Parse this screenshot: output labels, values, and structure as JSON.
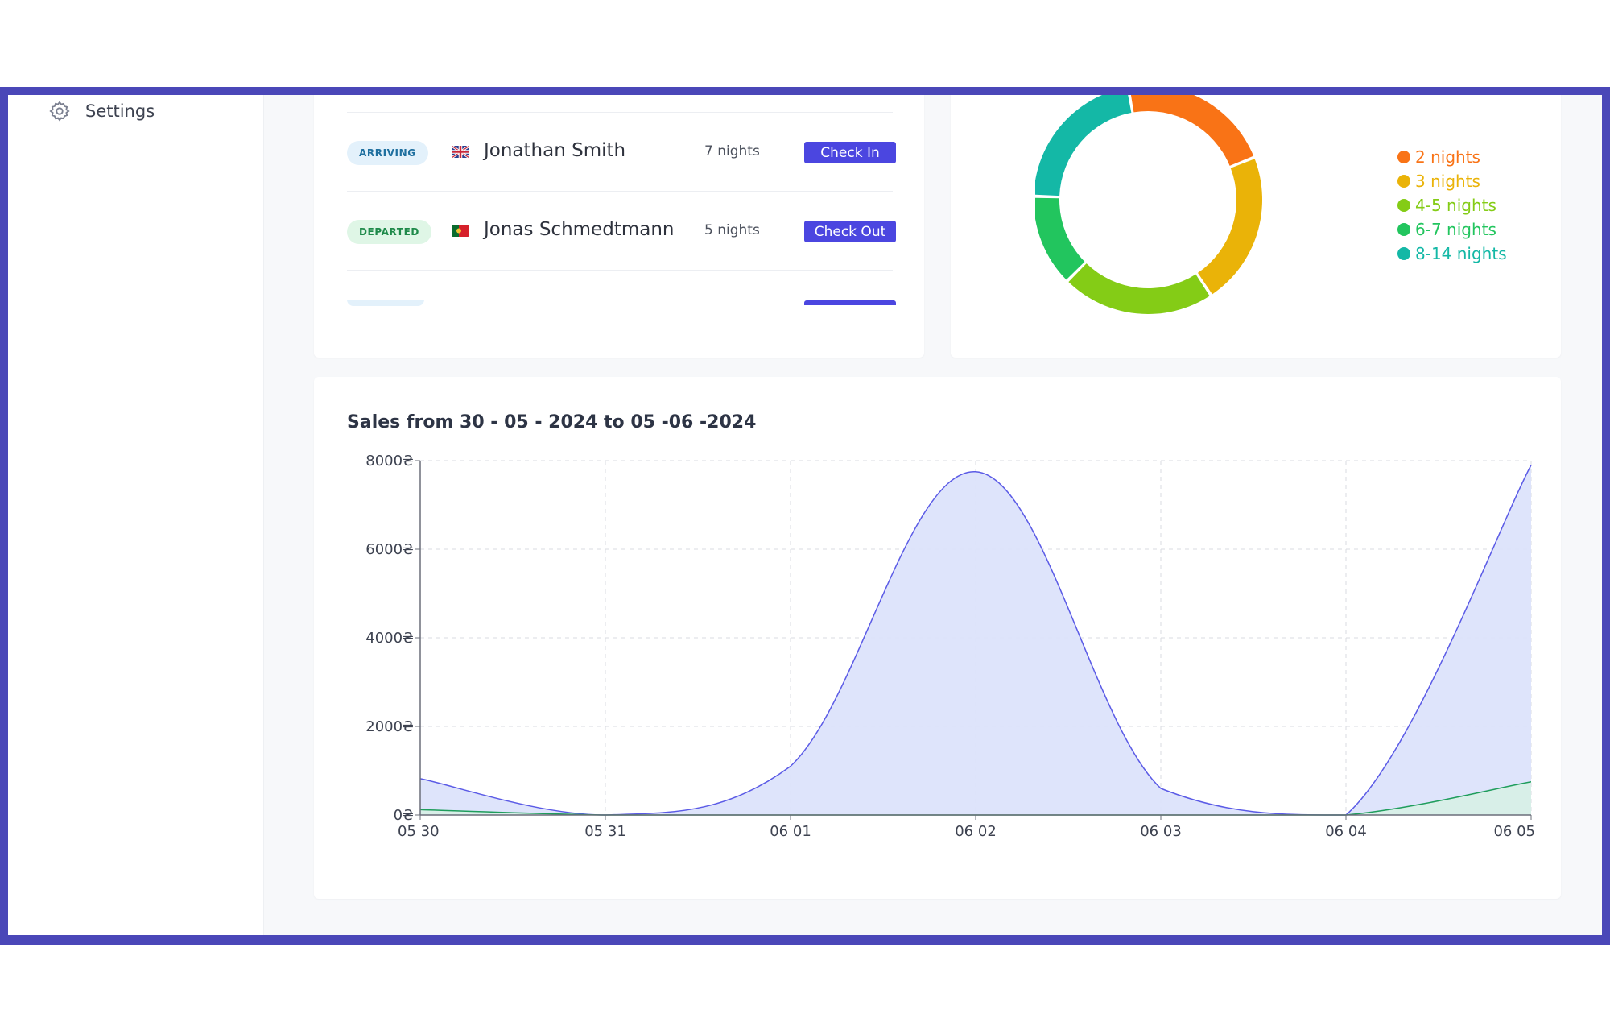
{
  "sidebar": {
    "settings": {
      "label": "Settings",
      "icon": "gear-icon"
    }
  },
  "guests": {
    "rows": [
      {
        "status": "ARRIVING",
        "flag": "gb-flag-icon",
        "name": "Jonathan Smith",
        "nights": "7 nights",
        "action": "Check In"
      },
      {
        "status": "DEPARTED",
        "flag": "pt-flag-icon",
        "name": "Jonas Schmedtmann",
        "nights": "5 nights",
        "action": "Check Out"
      }
    ]
  },
  "stay_duration": {
    "legend": [
      {
        "label": "2 nights",
        "color": "#f97316"
      },
      {
        "label": "3 nights",
        "color": "#eab308"
      },
      {
        "label": "4-5 nights",
        "color": "#84cc16"
      },
      {
        "label": "6-7 nights",
        "color": "#22c55e"
      },
      {
        "label": "8-14 nights",
        "color": "#14b8a6"
      }
    ]
  },
  "sales": {
    "title": "Sales from 30 - 05 - 2024 to 05 -06 -2024"
  },
  "chart_data": [
    {
      "type": "pie",
      "subtype": "donut",
      "categories": [
        "2 nights",
        "3 nights",
        "4-5 nights",
        "6-7 nights",
        "8-14 nights"
      ],
      "values": [
        1,
        1,
        1,
        0.6,
        1
      ],
      "colors": [
        "#f97316",
        "#eab308",
        "#84cc16",
        "#22c55e",
        "#14b8a6"
      ],
      "legend_position": "right"
    },
    {
      "type": "area",
      "title": "Sales from 30 - 05 - 2024 to 05 -06 -2024",
      "categories": [
        "05 30",
        "05 31",
        "06 01",
        "06 02",
        "06 03",
        "06 04",
        "06 05"
      ],
      "series": [
        {
          "values": [
            820,
            0,
            1100,
            7750,
            600,
            0,
            7900
          ],
          "stroke": "#5b5be6",
          "fill": "#dce3fb"
        },
        {
          "values": [
            120,
            0,
            0,
            0,
            0,
            0,
            750
          ],
          "stroke": "#1f9d5c",
          "fill": "#d7f0e6"
        }
      ],
      "yticks": [
        "0₴",
        "2000₴",
        "4000₴",
        "6000₴",
        "8000₴"
      ],
      "ylim": [
        0,
        8000
      ],
      "grid": true
    }
  ]
}
